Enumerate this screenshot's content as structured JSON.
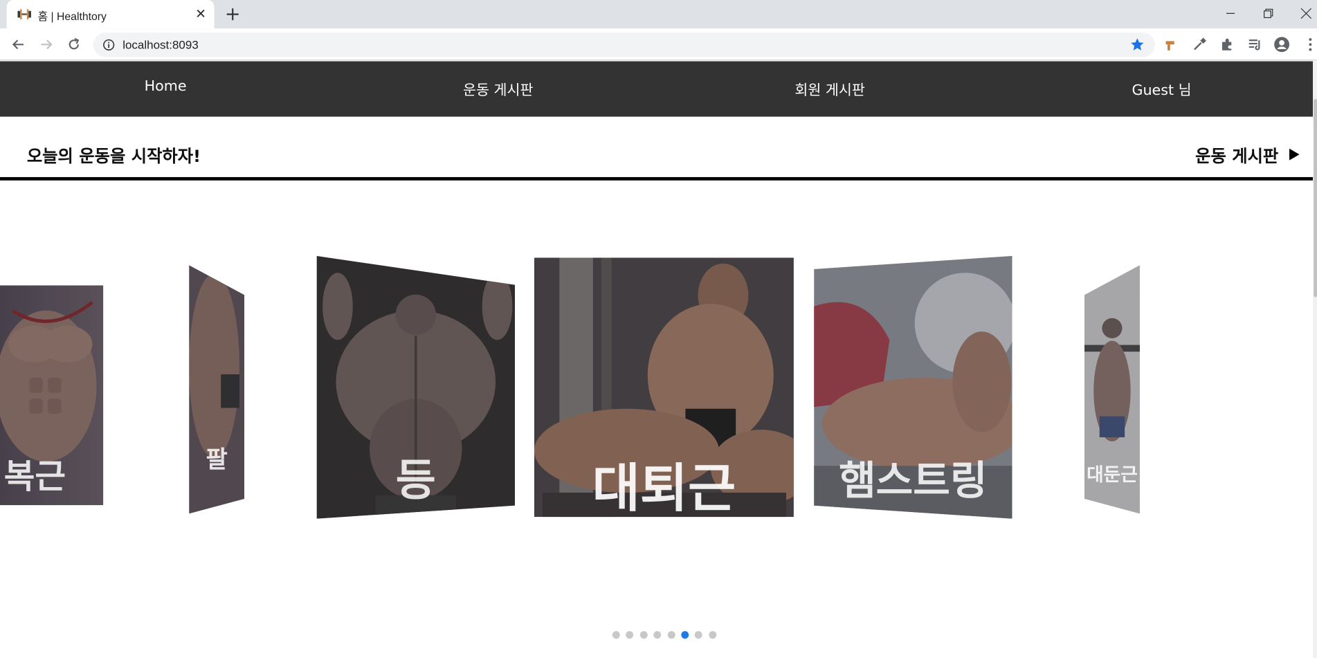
{
  "browser": {
    "tab_title": "홈 | Healthtory",
    "url": "localhost:8093"
  },
  "nav": {
    "home": "Home",
    "exercise_board": "운동 게시판",
    "member_board": "회원 게시판",
    "user": "Guest 님"
  },
  "page": {
    "headline": "오늘의 운동을 시작하자!",
    "board_link": "운동 게시판"
  },
  "carousel": {
    "slides": [
      {
        "label": "복근"
      },
      {
        "label": "팔"
      },
      {
        "label": "등"
      },
      {
        "label": "대퇴근"
      },
      {
        "label": "햄스트링"
      },
      {
        "label": "대둔근"
      }
    ],
    "dot_count": 8,
    "active_dot": 6
  },
  "colors": {
    "nav_bg": "#333333",
    "accent": "#1e7ce6"
  }
}
